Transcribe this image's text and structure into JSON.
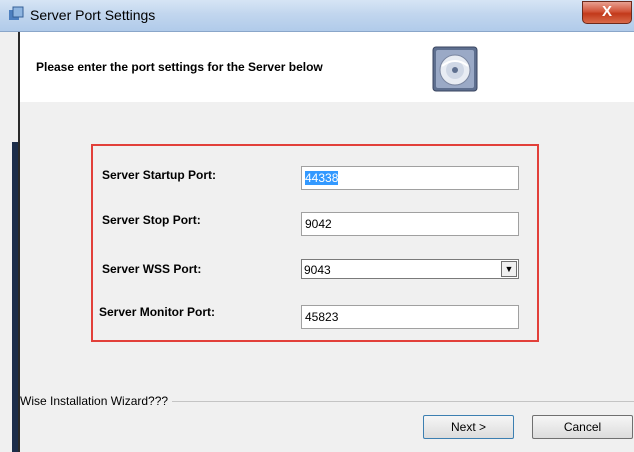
{
  "window": {
    "title": "Server Port Settings",
    "close_label": "X"
  },
  "header": {
    "instruction": "Please enter the port settings for the Server below"
  },
  "fields": [
    {
      "label": "Server Startup Port:",
      "value": "44338",
      "selected": true
    },
    {
      "label": "Server Stop Port:",
      "value": "9042"
    },
    {
      "label": "Server WSS Port:",
      "value": "9043",
      "type": "dropdown"
    },
    {
      "label": "Server Monitor Port:",
      "value": "45823"
    }
  ],
  "footer": {
    "wizard_label": "Wise Installation Wizard???",
    "next_label": "Next >",
    "cancel_label": "Cancel"
  },
  "colors": {
    "highlight_border": "#e2403a",
    "selection": "#3399ff"
  }
}
